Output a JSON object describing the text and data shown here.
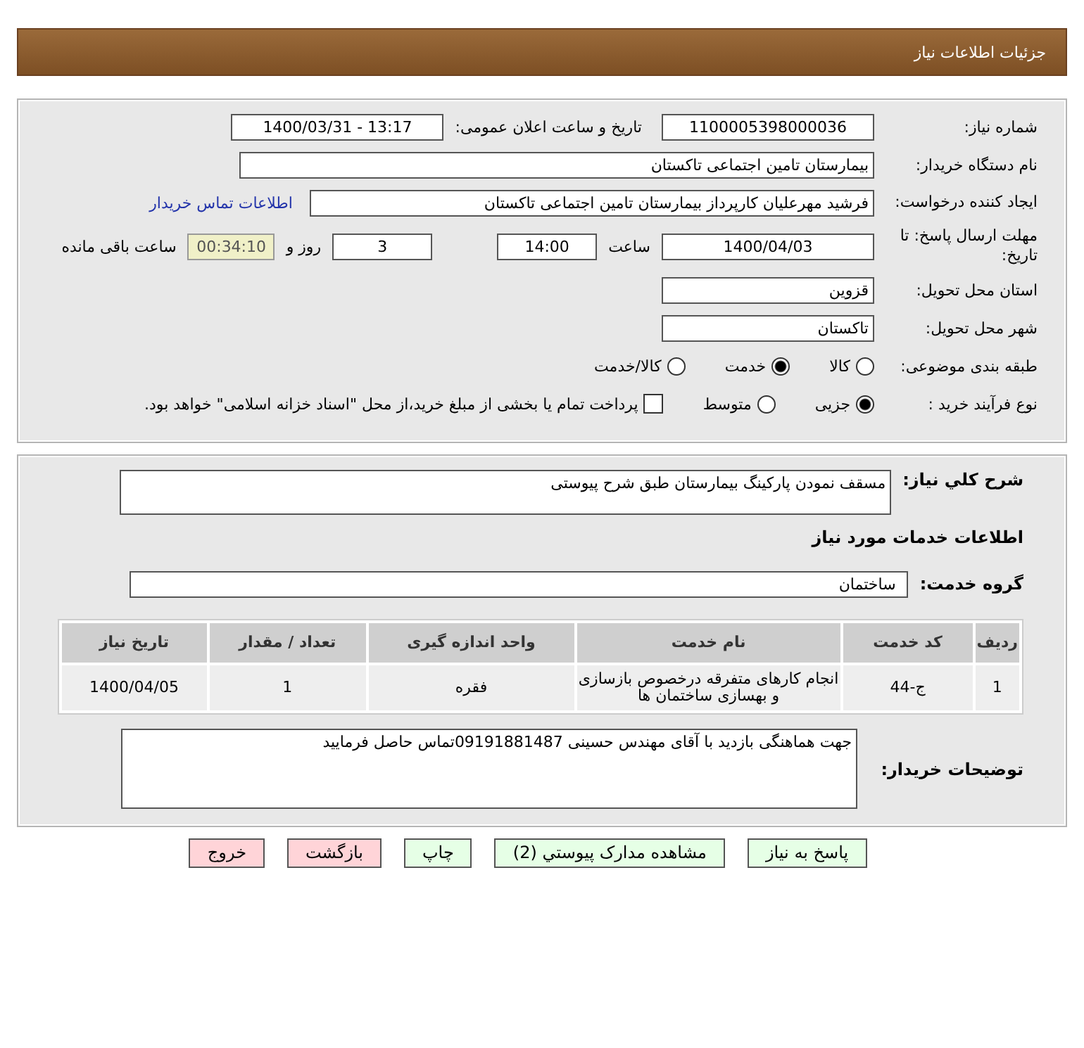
{
  "header": {
    "title": "جزئیات اطلاعات نیاز"
  },
  "details": {
    "need_number": {
      "label": "شماره نیاز:",
      "value": "1100005398000036"
    },
    "announce": {
      "label": "تاریخ و ساعت اعلان عمومی:",
      "value": "1400/03/31 - 13:17"
    },
    "buyer_org": {
      "label": "نام دستگاه خریدار:",
      "value": "بیمارستان تامین اجتماعی تاکستان"
    },
    "creator": {
      "label": "ایجاد کننده درخواست:",
      "value": "فرشید مهرعلیان کارپرداز بیمارستان تامین اجتماعی تاکستان",
      "link": "اطلاعات تماس خریدار"
    },
    "deadline": {
      "label": "مهلت ارسال پاسخ: تا تاریخ:",
      "date": "1400/04/03",
      "time_label": "ساعت",
      "time": "14:00",
      "days": "3",
      "days_label": "روز و",
      "remaining": "00:34:10",
      "remaining_label": "ساعت باقی مانده"
    },
    "province": {
      "label": "استان محل تحویل:",
      "value": "قزوین"
    },
    "city": {
      "label": "شهر محل تحویل:",
      "value": "تاکستان"
    },
    "category": {
      "label": "طبقه بندی موضوعی:",
      "options": [
        {
          "label": "کالا",
          "selected": false
        },
        {
          "label": "خدمت",
          "selected": true
        },
        {
          "label": "کالا/خدمت",
          "selected": false
        }
      ]
    },
    "process": {
      "label": "نوع فرآیند خرید :",
      "options": [
        {
          "label": "جزیی",
          "selected": true
        },
        {
          "label": "متوسط",
          "selected": false
        }
      ],
      "treasury": {
        "checked": false,
        "text": "پرداخت تمام یا بخشی از مبلغ خرید،از محل \"اسناد خزانه اسلامی\" خواهد بود."
      }
    }
  },
  "summary": {
    "label": "شرح کلي نياز:",
    "value": "مسقف نمودن پارکینگ بیمارستان طبق شرح پیوستی"
  },
  "services_heading": "اطلاعات خدمات مورد نیاز",
  "service_group": {
    "label": "گروه خدمت:",
    "value": "ساختمان"
  },
  "table": {
    "columns": [
      "ردیف",
      "کد خدمت",
      "نام خدمت",
      "واحد اندازه گیری",
      "تعداد / مقدار",
      "تاریخ نیاز"
    ],
    "rows": [
      [
        "1",
        "ج-44",
        "انجام کارهای متفرقه درخصوص بازسازی و بهسازی ساختمان ها",
        "فقره",
        "1",
        "1400/04/05"
      ]
    ]
  },
  "buyer_notes": {
    "label": "توضیحات خریدار:",
    "value": "جهت هماهنگی بازدید با آقای مهندس حسینی 09191881487تماس حاصل فرمایید"
  },
  "buttons": [
    {
      "label": "پاسخ به نیاز",
      "kind": "primary"
    },
    {
      "label": "مشاهده مدارک پیوستي (2)",
      "kind": "primary"
    },
    {
      "label": "چاپ",
      "kind": "primary"
    },
    {
      "label": "بازگشت",
      "kind": "danger"
    },
    {
      "label": "خروج",
      "kind": "danger"
    }
  ]
}
